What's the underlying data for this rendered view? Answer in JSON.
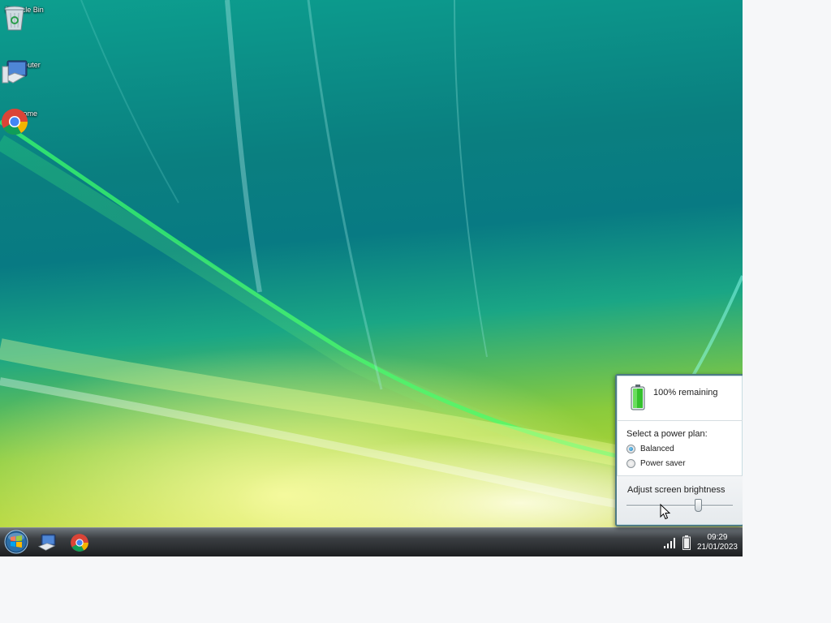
{
  "desktop": {
    "icons": [
      {
        "label": "Recycle Bin",
        "icon": "recycle-bin-icon"
      },
      {
        "label": "Computer",
        "icon": "computer-icon"
      },
      {
        "label": "Chrome",
        "icon": "chrome-icon"
      }
    ]
  },
  "taskbar": {
    "start_icon": "windows-start-orb-icon",
    "pinned": [
      {
        "icon": "computer-icon"
      },
      {
        "icon": "chrome-icon"
      }
    ],
    "tray": {
      "signal_icon": "signal-bars-icon",
      "battery_icon": "battery-icon",
      "time": "09:29",
      "date": "21/01/2023"
    }
  },
  "power_popup": {
    "battery_status": "100% remaining",
    "battery_level": 1.0,
    "plan_title": "Select a power plan:",
    "plans": [
      {
        "label": "Balanced",
        "selected": true
      },
      {
        "label": "Power saver",
        "selected": false
      }
    ],
    "brightness_label": "Adjust screen brightness",
    "brightness_level": 0.67
  },
  "colors": {
    "popup_border": "#4d7a84",
    "battery_green": "#35c12d",
    "radio_selected": "#1673b8"
  }
}
